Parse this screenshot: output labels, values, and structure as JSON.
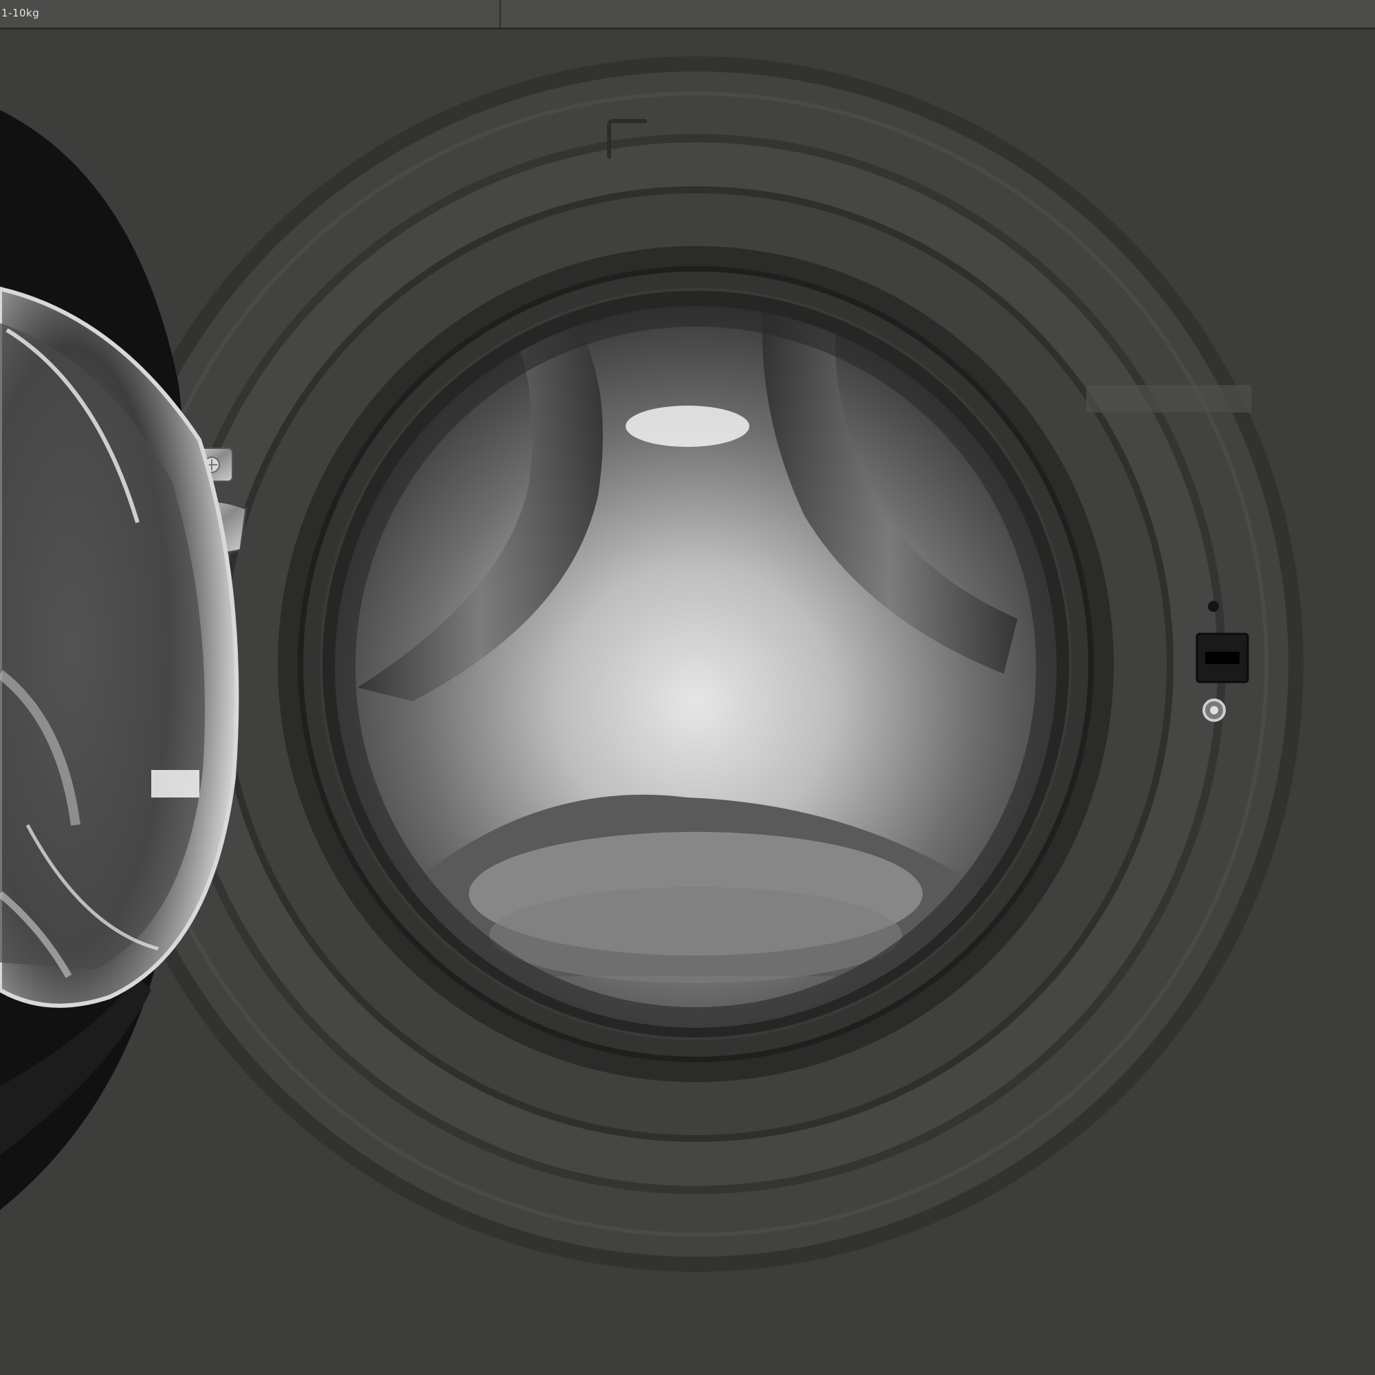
{
  "panel": {
    "capacity_label": "1-10kg"
  },
  "colors": {
    "body": "#3d3d3b",
    "top_strip": "#4b4b49",
    "gasket": "#2b2b2a",
    "drum_light": "#d9d9d9",
    "door_frame": "#111111"
  },
  "icons": {
    "lock": "key-slot-icon",
    "indicator": "indicator-led-icon",
    "sensor": "sensor-button-icon"
  }
}
